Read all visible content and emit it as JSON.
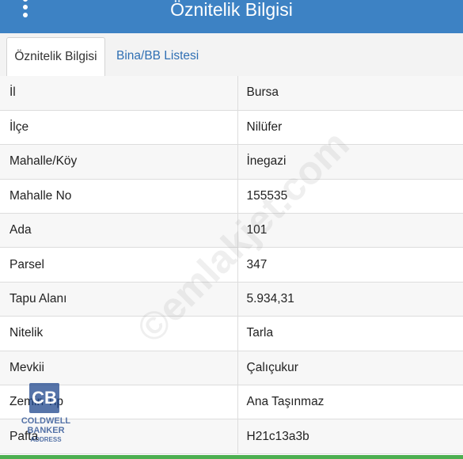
{
  "header": {
    "title": "Öznitelik Bilgisi",
    "menu_icon": "more-vertical-icon",
    "color": "#3d82c4"
  },
  "tabs": [
    {
      "label": "Öznitelik Bilgisi",
      "active": true
    },
    {
      "label": "Bina/BB Listesi",
      "active": false
    }
  ],
  "rows": [
    {
      "key": "İl",
      "value": "Bursa"
    },
    {
      "key": "İlçe",
      "value": "Nilüfer"
    },
    {
      "key": "Mahalle/Köy",
      "value": "İnegazi"
    },
    {
      "key": "Mahalle No",
      "value": "155535"
    },
    {
      "key": "Ada",
      "value": "101"
    },
    {
      "key": "Parsel",
      "value": "347"
    },
    {
      "key": "Tapu Alanı",
      "value": "5.934,31"
    },
    {
      "key": "Nitelik",
      "value": "Tarla"
    },
    {
      "key": "Mevkii",
      "value": "Çalıçukur"
    },
    {
      "key": "Zemin Tip",
      "value": "Ana Taşınmaz"
    },
    {
      "key": "Pafta",
      "value": "H21c13a3b"
    }
  ],
  "watermark": "©emlakjet.com",
  "logo": {
    "mark": "CB",
    "line1": "COLDWELL",
    "line2": "BANKER",
    "line3": "ADDRESS"
  },
  "accent": "#4caf50"
}
